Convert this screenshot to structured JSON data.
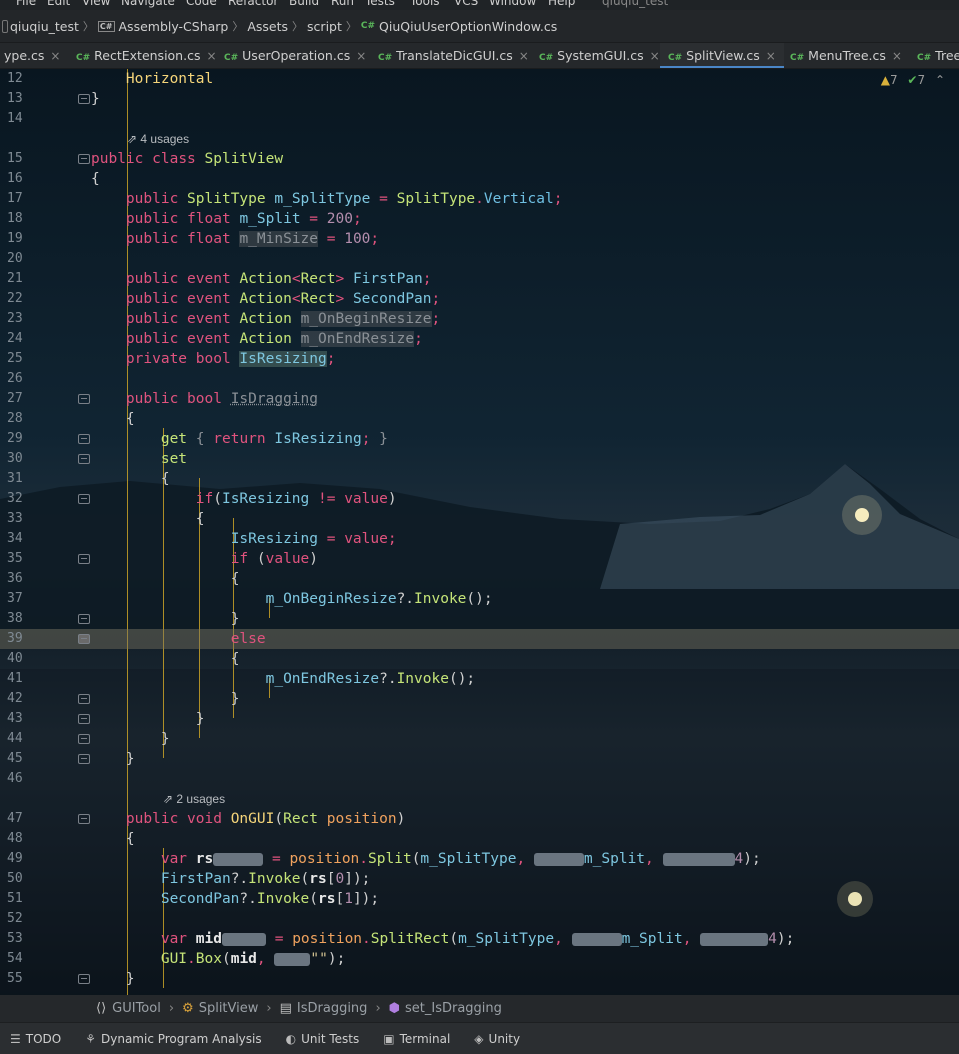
{
  "menu": [
    "File",
    "Edit",
    "View",
    "Navigate",
    "Code",
    "Refactor",
    "Build",
    "Run",
    "Tests",
    "Tools",
    "VCS",
    "Window",
    "Help"
  ],
  "window_title": "qiuqiu_test",
  "breadcrumb": {
    "project": "qiuqiu_test",
    "assembly": "Assembly-CSharp",
    "folder1": "Assets",
    "folder2": "script",
    "file": "QiuQiuUserOptionWindow.cs"
  },
  "tabs": [
    {
      "label": "ype.cs",
      "lang": ""
    },
    {
      "label": "RectExtension.cs",
      "lang": "C#"
    },
    {
      "label": "UserOperation.cs",
      "lang": "C#"
    },
    {
      "label": "TranslateDicGUI.cs",
      "lang": "C#"
    },
    {
      "label": "SystemGUI.cs",
      "lang": "C#"
    },
    {
      "label": "SplitView.cs",
      "lang": "C#"
    },
    {
      "label": "MenuTree.cs",
      "lang": "C#"
    },
    {
      "label": "Tree",
      "lang": "C#"
    }
  ],
  "inspections": {
    "warnings": "7",
    "ok": "7"
  },
  "hints": {
    "usages4": "4 usages",
    "usages2": "2 usages"
  },
  "lines": {
    "l12": "12",
    "l13": "13",
    "l14": "14",
    "l15": "15",
    "l16": "16",
    "l17": "17",
    "l18": "18",
    "l19": "19",
    "l20": "20",
    "l21": "21",
    "l22": "22",
    "l23": "23",
    "l24": "24",
    "l25": "25",
    "l26": "26",
    "l27": "27",
    "l28": "28",
    "l29": "29",
    "l30": "30",
    "l31": "31",
    "l32": "32",
    "l33": "33",
    "l34": "34",
    "l35": "35",
    "l36": "36",
    "l37": "37",
    "l38": "38",
    "l39": "39",
    "l40": "40",
    "l41": "41",
    "l42": "42",
    "l43": "43",
    "l44": "44",
    "l45": "45",
    "l46": "46",
    "l47": "47",
    "l48": "48",
    "l49": "49",
    "l50": "50",
    "l51": "51",
    "l52": "52",
    "l53": "53",
    "l54": "54",
    "l55": "55"
  },
  "code": {
    "horizontal": "Horizontal",
    "public": "public",
    "private": "private",
    "class": "class",
    "float": "float",
    "event": "event",
    "bool": "bool",
    "void": "void",
    "var": "var",
    "if": "if",
    "else": "else",
    "return": "return",
    "get": "get",
    "set": "set",
    "value": "value",
    "SplitView": "SplitView",
    "SplitType": "SplitType",
    "m_SplitType": "m_SplitType",
    "Vertical": "Vertical",
    "m_Split": "m_Split",
    "n200": "200",
    "m_MinSize": "m_MinSize",
    "n100": "100",
    "Action": "Action",
    "Rect": "Rect",
    "FirstPan": "FirstPan",
    "SecondPan": "SecondPan",
    "m_OnBeginResize": "m_OnBeginResize",
    "m_OnEndResize": "m_OnEndResize",
    "IsResizing": "IsResizing",
    "IsDragging": "IsDragging",
    "Invoke": "Invoke",
    "OnGUI": "OnGUI",
    "position": "position",
    "rs": "rs",
    "Split": "Split",
    "mid": "mid",
    "SplitRect": "SplitRect",
    "GUI": "GUI",
    "Box": "Box",
    "n4": "4",
    "n0": "0",
    "n1": "1",
    "emptystr": "\"\""
  },
  "breadcrumb_bottom": [
    "GUITool",
    "SplitView",
    "IsDragging",
    "set_IsDragging"
  ],
  "bottom_tabs": [
    "TODO",
    "Dynamic Program Analysis",
    "Unit Tests",
    "Terminal",
    "Unity"
  ]
}
